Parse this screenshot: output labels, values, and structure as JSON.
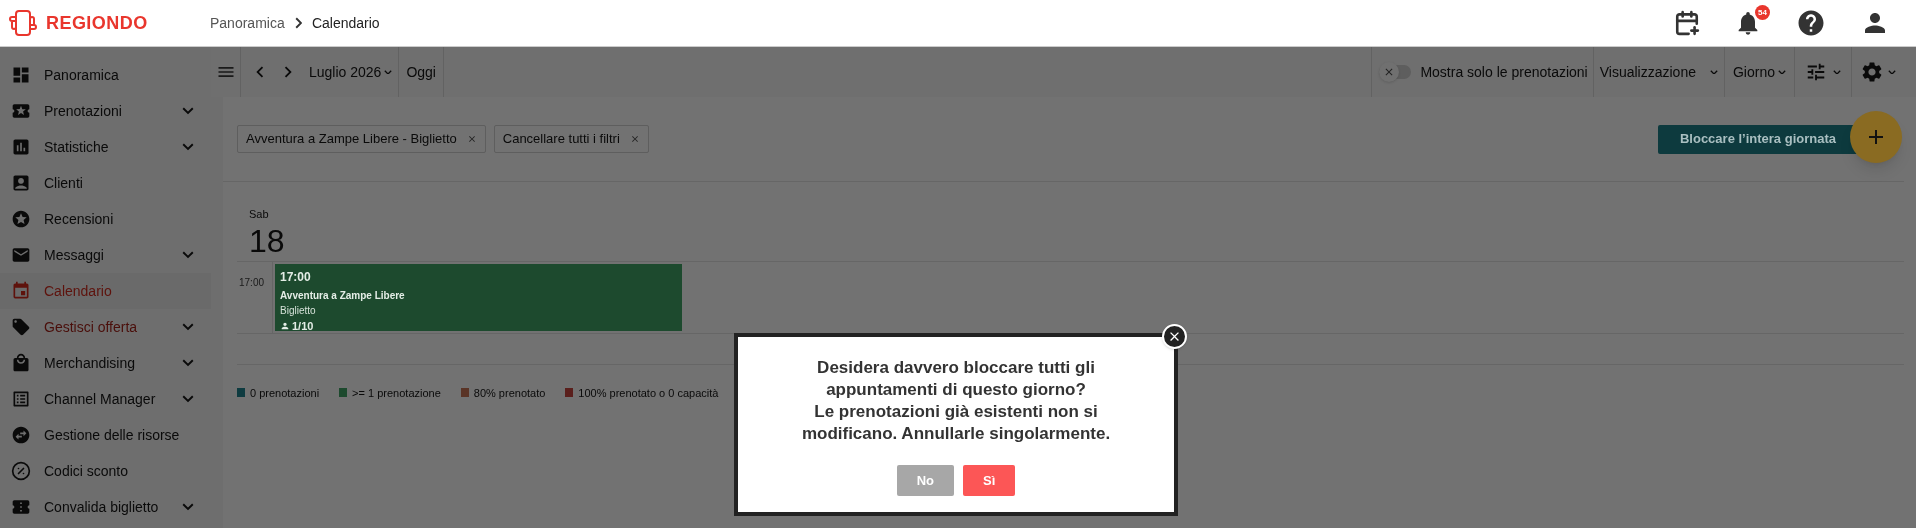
{
  "header": {
    "logo": "REGIONDO",
    "breadcrumb": [
      {
        "label": "Panoramica"
      },
      {
        "label": "Calendario"
      }
    ],
    "notifications": "54"
  },
  "sidebar": {
    "items": [
      {
        "label": "Panoramica",
        "expandable": false,
        "selected": false,
        "hovered": false
      },
      {
        "label": "Prenotazioni",
        "expandable": true,
        "selected": false,
        "hovered": false
      },
      {
        "label": "Statistiche",
        "expandable": true,
        "selected": false,
        "hovered": false
      },
      {
        "label": "Clienti",
        "expandable": false,
        "selected": false,
        "hovered": false
      },
      {
        "label": "Recensioni",
        "expandable": false,
        "selected": false,
        "hovered": false
      },
      {
        "label": "Messaggi",
        "expandable": true,
        "selected": false,
        "hovered": false
      },
      {
        "label": "Calendario",
        "expandable": false,
        "selected": true,
        "hovered": false
      },
      {
        "label": "Gestisci offerta",
        "expandable": true,
        "selected": false,
        "hovered": true
      },
      {
        "label": "Merchandising",
        "expandable": true,
        "selected": false,
        "hovered": false
      },
      {
        "label": "Channel Manager",
        "expandable": true,
        "selected": false,
        "hovered": false
      },
      {
        "label": "Gestione delle risorse",
        "expandable": false,
        "selected": false,
        "hovered": false
      },
      {
        "label": "Codici sconto",
        "expandable": false,
        "selected": false,
        "hovered": false
      },
      {
        "label": "Convalida biglietto",
        "expandable": true,
        "selected": false,
        "hovered": false
      }
    ]
  },
  "toolbar": {
    "month": "Luglio 2026",
    "today": "Oggi",
    "only_bookings": {
      "label": "Mostra solo le prenotazioni",
      "on": false
    },
    "view": "Visualizzazione",
    "range": "Giorno"
  },
  "filters": [
    {
      "label": "Avventura a Zampe Libere - Biglietto"
    },
    {
      "label": "Cancellare tutti i filtri"
    }
  ],
  "block_button": "Bloccare l’intera giornata",
  "day": {
    "weekday": "Sab",
    "number": "18"
  },
  "slots": [
    {
      "time": "17:00",
      "event": {
        "time": "17:00",
        "title": "Avventura a Zampe Libere",
        "subtitle": "Biglietto",
        "capacity": "1/10",
        "color": "#1d4a2e"
      }
    }
  ],
  "legend": [
    {
      "label": "0 prenotazioni",
      "color": "#0e3b40"
    },
    {
      "label": ">= 1 prenotazione",
      "color": "#1d4a2e"
    },
    {
      "label": "80% prenotato",
      "color": "#5a3426"
    },
    {
      "label": "100% prenotato o 0 capacità",
      "color": "#5a1f1c"
    }
  ],
  "dialog": {
    "message": "Desidera davvero bloccare tutti gli appuntamenti di questo giorno?\nLe prenotazioni già esistenti non si modificano. Annullarle singolarmente.",
    "buttons": [
      {
        "label": "No",
        "kind": "cancel"
      },
      {
        "label": "Sì",
        "kind": "confirm"
      }
    ]
  }
}
